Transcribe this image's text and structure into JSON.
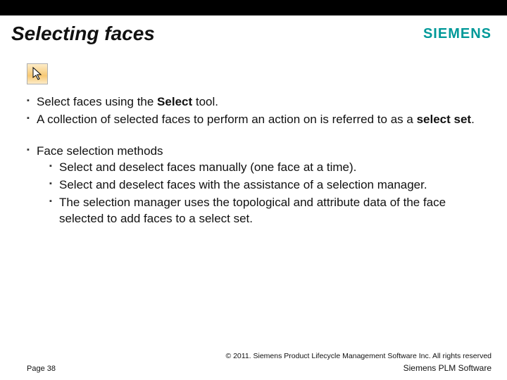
{
  "header": {
    "title": "Selecting faces",
    "logo_text": "SIEMENS"
  },
  "icon": {
    "name": "cursor-select-icon"
  },
  "bullets_top": {
    "b0_pre": "Select faces using the ",
    "b0_bold": "Select",
    "b0_post": " tool.",
    "b1_pre": "A collection of selected faces to perform an action on is referred to as a ",
    "b1_bold": "select set",
    "b1_post": "."
  },
  "bullets_methods": {
    "heading": "Face selection methods",
    "items": [
      "Select and deselect faces manually (one face at a time).",
      "Select and deselect faces with the assistance of a selection manager.",
      "The selection manager uses the topological and attribute data of the face selected to add faces to a select set."
    ]
  },
  "footer": {
    "copyright": "© 2011. Siemens Product Lifecycle Management Software Inc. All rights reserved",
    "page_label": "Page 38",
    "plm_label": "Siemens PLM Software"
  }
}
